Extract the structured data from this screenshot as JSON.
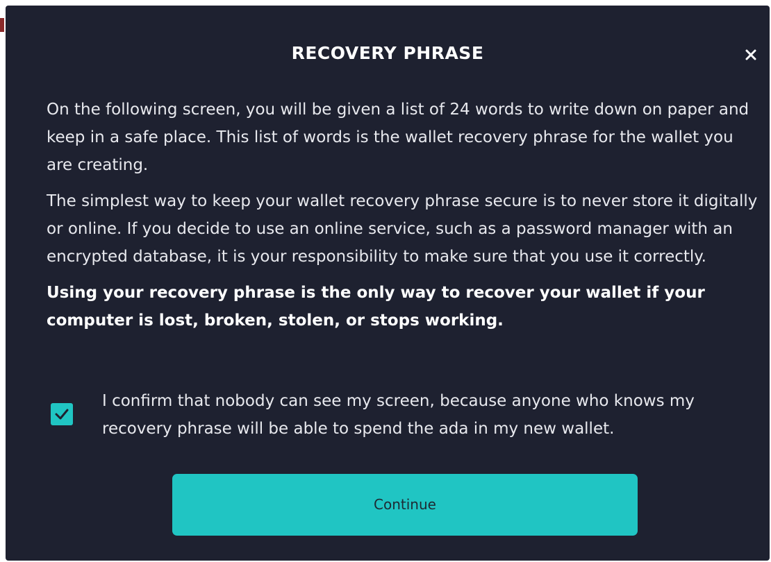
{
  "dialog": {
    "title": "RECOVERY PHRASE",
    "close_icon": "close-icon",
    "paragraphs": [
      "On the following screen, you will be given a list of 24 words to write down on paper and keep in a safe place. This list of words is the wallet recovery phrase for the wallet you are creating.",
      "The simplest way to keep your wallet recovery phrase secure is to never store it digitally or online. If you decide to use an online service, such as a password manager with an encrypted database, it is your responsibility to make sure that you use it correctly."
    ],
    "warning": "Using your recovery phrase is the only way to recover your wallet if your computer is lost, broken, stolen, or stops working.",
    "confirm": {
      "checked": true,
      "check_icon": "checkmark-icon",
      "label": "I confirm that nobody can see my screen, because anyone who knows my recovery phrase will be able to spend the ada in my new wallet."
    },
    "continue_label": "Continue"
  },
  "colors": {
    "dialog_background": "#1e2130",
    "accent": "#20c5c3",
    "text": "#e8e9ee"
  }
}
